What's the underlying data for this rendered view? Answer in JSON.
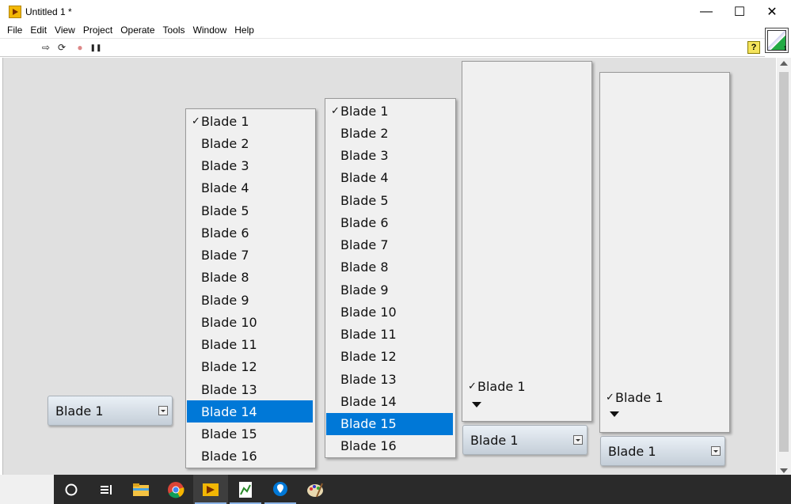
{
  "window": {
    "title": "Untitled 1 *",
    "min_glyph": "—",
    "max_glyph": "☐",
    "close_glyph": "✕"
  },
  "menu": [
    "File",
    "Edit",
    "View",
    "Project",
    "Operate",
    "Tools",
    "Window",
    "Help"
  ],
  "toolbar": {
    "run_icon": "⇨",
    "run_continuous_icon": "⟳",
    "abort_icon": "●",
    "pause_icon": "❚❚",
    "help_icon": "?"
  },
  "vi_icon": {
    "number": "1"
  },
  "controls": [
    {
      "ring_label": "Blade 1"
    },
    {
      "ring_label": "Blade 1"
    },
    {
      "ring_label": "Blade 1"
    },
    {
      "ring_label": "Blade 1"
    }
  ],
  "list1": {
    "checked": "Blade 1",
    "selected": "Blade 14",
    "items": [
      "Blade 1",
      "Blade 2",
      "Blade 3",
      "Blade 4",
      "Blade 5",
      "Blade 6",
      "Blade 7",
      "Blade 8",
      "Blade 9",
      "Blade 10",
      "Blade 11",
      "Blade 12",
      "Blade 13",
      "Blade 14",
      "Blade 15",
      "Blade 16"
    ]
  },
  "list2": {
    "checked": "Blade 1",
    "selected": "Blade 15",
    "items": [
      "Blade 1",
      "Blade 2",
      "Blade 3",
      "Blade 4",
      "Blade 5",
      "Blade 6",
      "Blade 7",
      "Blade 8",
      "Blade 9",
      "Blade 10",
      "Blade 11",
      "Blade 12",
      "Blade 13",
      "Blade 14",
      "Blade 15",
      "Blade 16"
    ]
  },
  "list3": {
    "items": [
      "Blade 1"
    ],
    "checked": "Blade 1"
  },
  "list4": {
    "items": [
      "Blade 1"
    ],
    "checked": "Blade 1"
  },
  "check_glyph": "✓",
  "taskbar": {
    "icons": [
      "cortana-icon",
      "task-view-icon",
      "file-explorer-icon",
      "chrome-icon",
      "labview-icon",
      "vi-editor-icon",
      "maps-icon",
      "paint-icon"
    ],
    "active": "labview-icon",
    "colors": {
      "taskbar": "#2a2a2a",
      "highlight": "#0078d7"
    }
  }
}
